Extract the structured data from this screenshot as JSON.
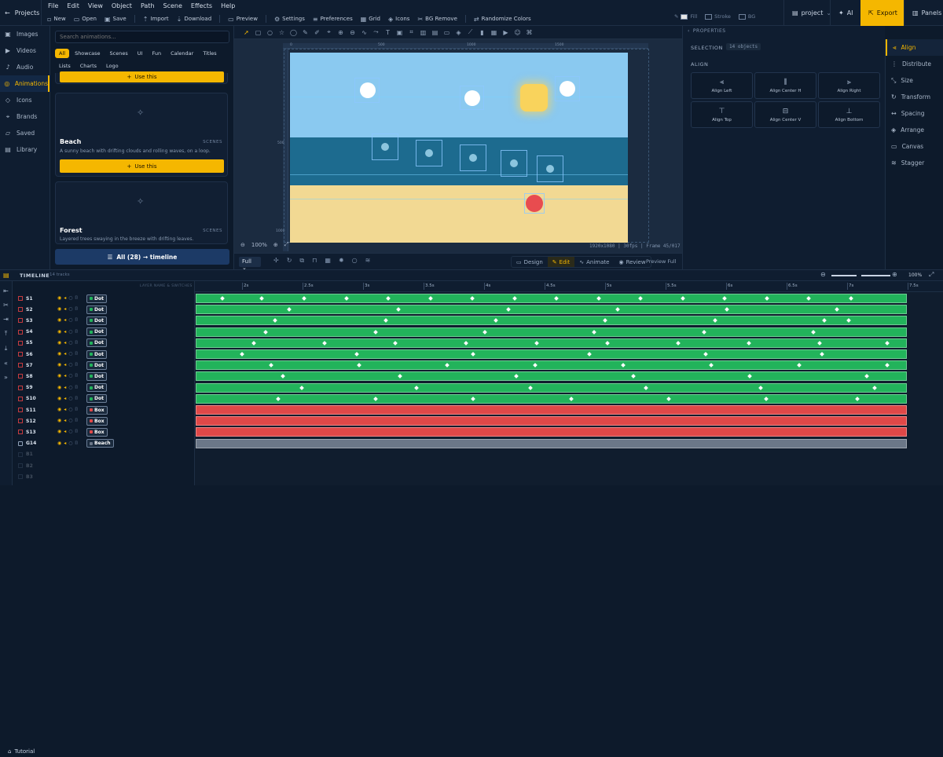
{
  "topbar": {
    "projects": "Projects",
    "menu": [
      "File",
      "Edit",
      "View",
      "Object",
      "Path",
      "Scene",
      "Effects",
      "Help"
    ],
    "tools": [
      "New",
      "Open",
      "Save",
      "Import",
      "Download",
      "Preview",
      "Settings",
      "Preferences",
      "Grid",
      "Icons",
      "BG Remove",
      "Randomize Colors"
    ],
    "fill": "Fill",
    "stroke": "Stroke",
    "bg": "BG",
    "project": "project",
    "ai": "AI",
    "export": "Export",
    "panels": "Panels"
  },
  "nav": [
    "Images",
    "Videos",
    "Audio",
    "Animations",
    "Icons",
    "Brands",
    "Saved",
    "Library"
  ],
  "nav_active": "Animations",
  "library": {
    "search_placeholder": "Search animations...",
    "chips": [
      "All",
      "Showcase",
      "Scenes",
      "UI",
      "Fun",
      "Calendar",
      "Titles",
      "Lists",
      "Charts",
      "Logo"
    ],
    "use_label": "Use this",
    "cards": [
      {
        "title": "Beach",
        "tag": "SCENES",
        "desc": "A sunny beach with drifting clouds and rolling waves, on a loop."
      },
      {
        "title": "Forest",
        "tag": "SCENES",
        "desc": "Layered trees swaying in the breeze with drifting leaves."
      }
    ],
    "all_timeline": "All (28) → timeline"
  },
  "canvas": {
    "zoom": "100%",
    "info": "1920x1080 | 30fps | Frame 45/017",
    "ruler_top": [
      "0",
      "500",
      "1000",
      "1500"
    ],
    "ruler_left": [
      "500",
      "1000"
    ],
    "fit": "Full",
    "modes": [
      "Design",
      "Edit",
      "Animate",
      "Review"
    ],
    "active_mode": "Edit",
    "preview": "Preview Full"
  },
  "properties": {
    "header": "PROPERTIES",
    "selection_label": "SELECTION",
    "selection_value": "14 objects",
    "align_header": "ALIGN",
    "align_buttons": [
      "Align Left",
      "Align Center H",
      "Align Right",
      "Align Top",
      "Align Center V",
      "Align Bottom"
    ]
  },
  "right_nav": [
    "Align",
    "Distribute",
    "Size",
    "Transform",
    "Spacing",
    "Arrange",
    "Canvas",
    "Stagger"
  ],
  "timeline": {
    "title": "TIMELINE",
    "count": "14 tracks",
    "layer_header": "LAYER NAME & SWITCHES",
    "zoom": "100%",
    "ticks": [
      "2s",
      "2.5s",
      "3s",
      "3.5s",
      "4s",
      "4.5s",
      "5s",
      "5.5s",
      "6s",
      "6.5s",
      "7s",
      "7.5s"
    ],
    "tracks": [
      {
        "name": "S1",
        "type": "Dot",
        "color": "#22b35b",
        "kf": [
          0.037,
          0.092,
          0.152,
          0.211,
          0.27,
          0.33,
          0.389,
          0.448,
          0.507,
          0.567,
          0.626,
          0.685,
          0.744,
          0.804,
          0.863,
          0.922
        ]
      },
      {
        "name": "S2",
        "type": "Dot",
        "color": "#22b35b",
        "kf": [
          0.131,
          0.285,
          0.44,
          0.594,
          0.748,
          0.902
        ]
      },
      {
        "name": "S3",
        "type": "Dot",
        "color": "#22b35b",
        "kf": [
          0.111,
          0.267,
          0.422,
          0.576,
          0.731,
          0.885,
          0.919
        ]
      },
      {
        "name": "S4",
        "type": "Dot",
        "color": "#22b35b",
        "kf": [
          0.097,
          0.252,
          0.406,
          0.56,
          0.715,
          0.869
        ]
      },
      {
        "name": "S5",
        "type": "Dot",
        "color": "#22b35b",
        "kf": [
          0.081,
          0.18,
          0.28,
          0.38,
          0.48,
          0.579,
          0.679,
          0.778,
          0.878,
          0.973
        ]
      },
      {
        "name": "S6",
        "type": "Dot",
        "color": "#22b35b",
        "kf": [
          0.064,
          0.226,
          0.39,
          0.554,
          0.718,
          0.881
        ]
      },
      {
        "name": "S7",
        "type": "Dot",
        "color": "#22b35b",
        "kf": [
          0.105,
          0.229,
          0.353,
          0.477,
          0.601,
          0.725,
          0.849,
          0.973
        ]
      },
      {
        "name": "S8",
        "type": "Dot",
        "color": "#22b35b",
        "kf": [
          0.122,
          0.287,
          0.451,
          0.616,
          0.78,
          0.945
        ]
      },
      {
        "name": "S9",
        "type": "Dot",
        "color": "#22b35b",
        "kf": [
          0.148,
          0.31,
          0.471,
          0.633,
          0.795,
          0.956
        ]
      },
      {
        "name": "S10",
        "type": "Dot",
        "color": "#22b35b",
        "kf": [
          0.115,
          0.253,
          0.39,
          0.528,
          0.666,
          0.803,
          0.931
        ]
      },
      {
        "name": "S11",
        "type": "Box",
        "color": "#e04848",
        "kf": []
      },
      {
        "name": "S12",
        "type": "Box",
        "color": "#e04848",
        "kf": []
      },
      {
        "name": "S13",
        "type": "Box",
        "color": "#e04848",
        "kf": []
      },
      {
        "name": "G14",
        "type": "Beach",
        "color": "#6b7788",
        "kf": []
      }
    ],
    "ghost_tracks": [
      "B1",
      "B2",
      "B3"
    ]
  },
  "tutorial": "Tutorial",
  "colors": {
    "accent": "#f5b700",
    "sky": "#8ac9f0",
    "sea": "#1d6b8f",
    "sand": "#f2d993",
    "sun": "#f9d35c",
    "ball": "#e84c4f"
  }
}
